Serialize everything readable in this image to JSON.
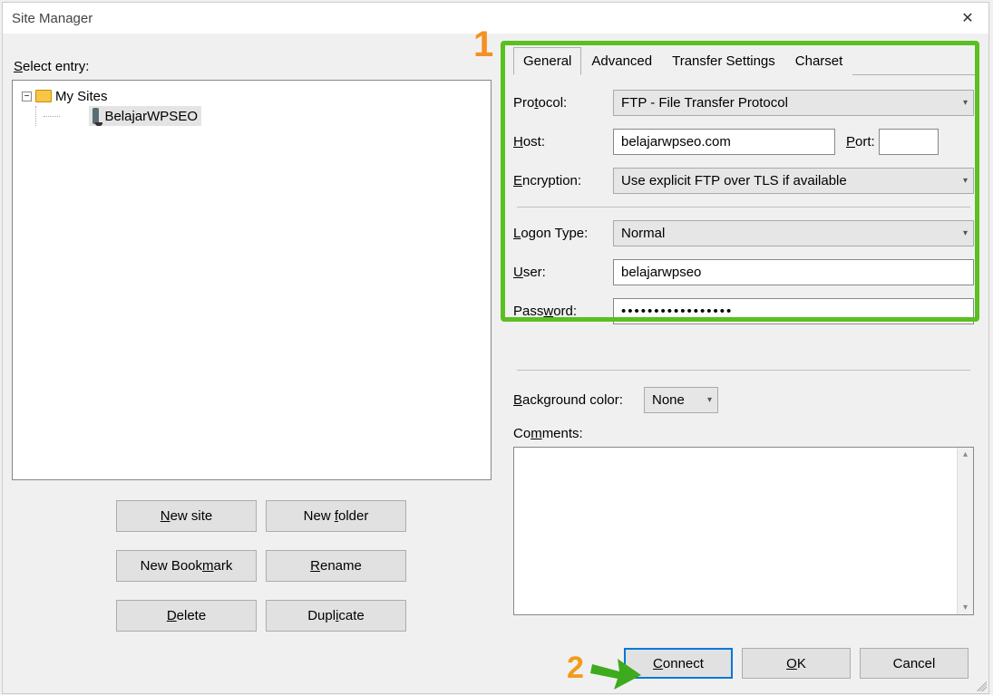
{
  "titlebar": {
    "title": "Site Manager"
  },
  "annotations": {
    "one": "1",
    "two": "2"
  },
  "left": {
    "select_label": "Select entry:",
    "tree": {
      "root": "My Sites",
      "item": "BelajarWPSEO"
    },
    "buttons": {
      "new_site": "New site",
      "new_folder": "New folder",
      "new_bookmark": "New Bookmark",
      "rename": "Rename",
      "delete": "Delete",
      "duplicate": "Duplicate"
    }
  },
  "tabs": {
    "general": "General",
    "advanced": "Advanced",
    "transfer": "Transfer Settings",
    "charset": "Charset"
  },
  "form": {
    "protocol_label": "Protocol:",
    "protocol_value": "FTP - File Transfer Protocol",
    "host_label": "Host:",
    "host_value": "belajarwpseo.com",
    "port_label": "Port:",
    "port_value": "",
    "encryption_label": "Encryption:",
    "encryption_value": "Use explicit FTP over TLS if available",
    "logon_label": "Logon Type:",
    "logon_value": "Normal",
    "user_label": "User:",
    "user_value": "belajarwpseo",
    "password_label": "Password:",
    "password_value": "•••••••••••••••••",
    "bgcolor_label": "Background color:",
    "bgcolor_value": "None",
    "comments_label": "Comments:"
  },
  "bottom": {
    "connect": "Connect",
    "ok": "OK",
    "cancel": "Cancel"
  }
}
